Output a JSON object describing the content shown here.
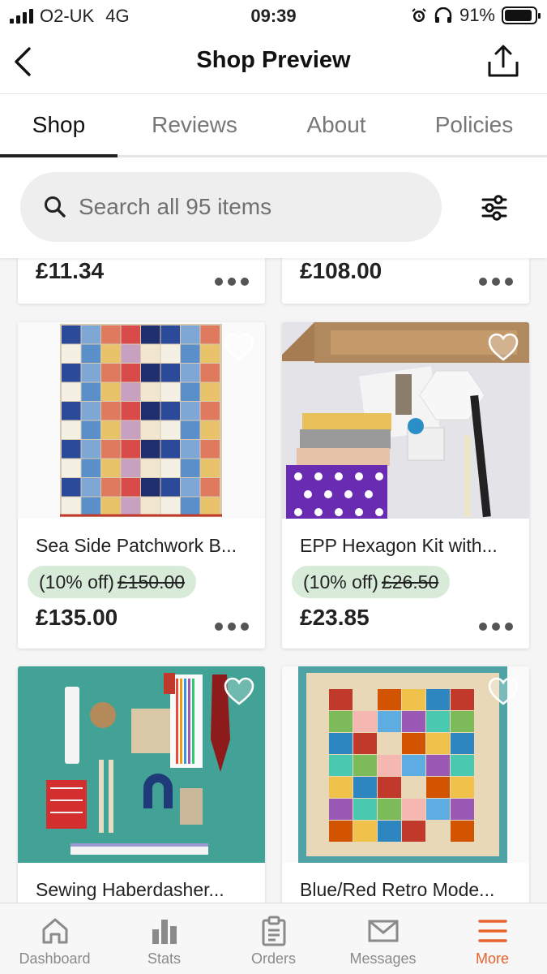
{
  "status_bar": {
    "carrier": "O2-UK",
    "network": "4G",
    "time": "09:39",
    "battery": "91%",
    "battery_level": 0.91
  },
  "header": {
    "title": "Shop Preview",
    "back_icon": "chevron-left-icon",
    "share_icon": "share-icon"
  },
  "tabs": [
    {
      "label": "Shop",
      "active": true
    },
    {
      "label": "Reviews",
      "active": false
    },
    {
      "label": "About",
      "active": false
    },
    {
      "label": "Policies",
      "active": false
    }
  ],
  "search": {
    "placeholder": "Search all 95 items",
    "value": ""
  },
  "listings": {
    "partial_row": [
      {
        "price": "£11.34"
      },
      {
        "price": "£108.00"
      }
    ],
    "items": [
      {
        "title": "Sea Side Patchwork B...",
        "discount": "(10% off)",
        "original_price": "£150.00",
        "price": "£135.00"
      },
      {
        "title": "EPP Hexagon Kit with...",
        "discount": "(10% off)",
        "original_price": "£26.50",
        "price": "£23.85"
      },
      {
        "title": "Sewing Haberdasher..."
      },
      {
        "title": "Blue/Red Retro Mode..."
      }
    ]
  },
  "bottom_nav": [
    {
      "label": "Dashboard",
      "icon": "home-icon",
      "active": false
    },
    {
      "label": "Stats",
      "icon": "bar-chart-icon",
      "active": false
    },
    {
      "label": "Orders",
      "icon": "clipboard-icon",
      "active": false
    },
    {
      "label": "Messages",
      "icon": "envelope-icon",
      "active": false
    },
    {
      "label": "More",
      "icon": "menu-icon",
      "active": true
    }
  ],
  "colors": {
    "accent": "#e8622c",
    "discount_bg": "#d8ebd9",
    "search_bg": "#eeeeee"
  }
}
